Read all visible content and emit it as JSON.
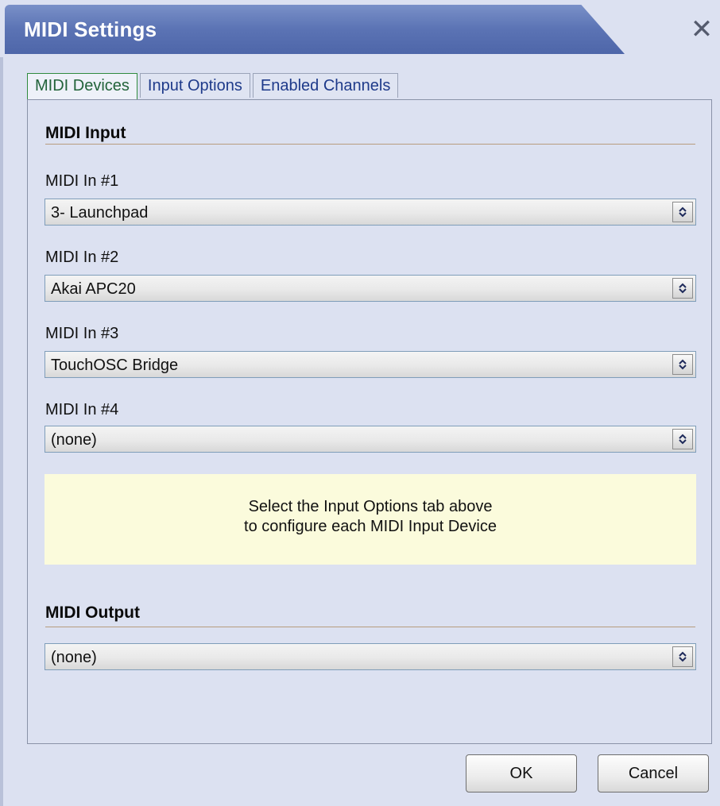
{
  "window": {
    "title": "MIDI Settings",
    "close_glyph": "✕"
  },
  "tabs": [
    {
      "label": "MIDI Devices",
      "active": true
    },
    {
      "label": "Input Options",
      "active": false
    },
    {
      "label": "Enabled Channels",
      "active": false
    }
  ],
  "midi_input": {
    "heading": "MIDI Input",
    "inputs": [
      {
        "label": "MIDI In #1",
        "value": "3- Launchpad"
      },
      {
        "label": "MIDI In #2",
        "value": "Akai APC20"
      },
      {
        "label": "MIDI In #3",
        "value": "TouchOSC Bridge"
      },
      {
        "label": "MIDI In #4",
        "value": "(none)"
      }
    ],
    "note_line1": "Select the Input Options tab above",
    "note_line2": "to configure each MIDI Input Device"
  },
  "midi_output": {
    "heading": "MIDI Output",
    "value": "(none)"
  },
  "buttons": {
    "ok": "OK",
    "cancel": "Cancel"
  },
  "icons": {
    "close": "close-icon",
    "select_arrow": "updown-chevron-icon"
  }
}
